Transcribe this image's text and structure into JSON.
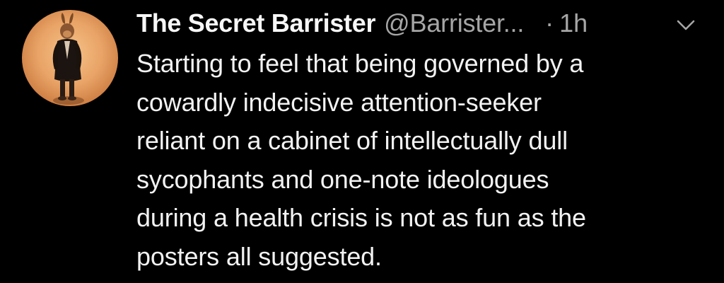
{
  "tweet": {
    "display_name": "The Secret Barrister",
    "handle": "@Barrister...",
    "separator": "·",
    "timestamp": "1h",
    "menu_icon": "chevron-down-icon",
    "avatar_icon": "profile-photo-rabbit-figure",
    "text_lines": [
      "Starting to feel that being governed by a",
      "cowardly indecisive attention-seeker",
      "reliant on a cabinet of intellectually dull",
      "sycophants and one-note ideologues",
      "during a health crisis is not as fun as the",
      "posters all suggested."
    ]
  },
  "colors": {
    "background": "#000000",
    "primary_text": "#f2f2f2",
    "secondary_text": "#a6a6a6"
  }
}
